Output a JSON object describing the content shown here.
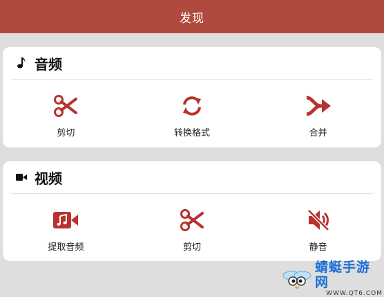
{
  "header": {
    "title": "发现"
  },
  "sections": [
    {
      "title": "音频",
      "icon": "music-note-icon",
      "tools": [
        {
          "label": "剪切",
          "icon": "scissors-icon"
        },
        {
          "label": "转换格式",
          "icon": "convert-arrows-icon"
        },
        {
          "label": "合并",
          "icon": "merge-arrow-icon"
        }
      ]
    },
    {
      "title": "视频",
      "icon": "video-camera-icon",
      "tools": [
        {
          "label": "提取音频",
          "icon": "video-music-icon"
        },
        {
          "label": "剪切",
          "icon": "scissors-icon"
        },
        {
          "label": "静音",
          "icon": "mute-speaker-icon"
        }
      ]
    }
  ],
  "watermark": {
    "main": "蜻蜓手游网",
    "sub": "WWW.QT6.COM"
  },
  "colors": {
    "header_bg": "#b14a3e",
    "accent": "#b8322f",
    "page_bg": "#dedede"
  }
}
